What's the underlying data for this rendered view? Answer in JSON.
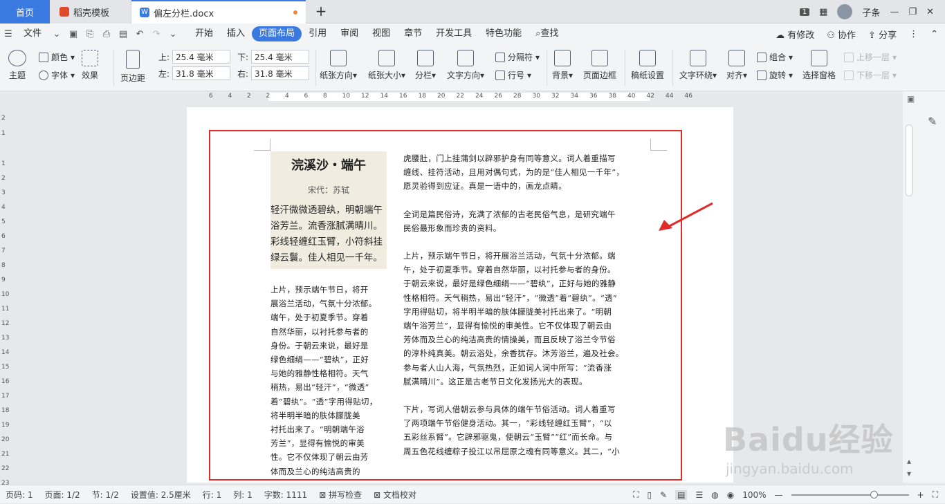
{
  "tabs": {
    "home": "首页",
    "template": "稻壳模板",
    "doc": "偏左分栏.docx",
    "add": "+"
  },
  "window": {
    "badge": "1",
    "user": "子条"
  },
  "menu": {
    "file": "文件",
    "items": [
      "开始",
      "插入",
      "页面布局",
      "引用",
      "审阅",
      "视图",
      "章节",
      "开发工具",
      "特色功能"
    ],
    "active_index": 2,
    "search": "查找",
    "right": [
      "有修改",
      "协作",
      "分享"
    ]
  },
  "ribbon": {
    "theme": "主题",
    "color": "颜色",
    "font": "字体",
    "effect": "效果",
    "margin": "页边距",
    "top_label": "上:",
    "top_value": "25.4 毫米",
    "bottom_label": "下:",
    "bottom_value": "25.4 毫米",
    "left_label": "左:",
    "left_value": "31.8 毫米",
    "right_label": "右:",
    "right_value": "31.8 毫米",
    "orientation": "纸张方向",
    "size": "纸张大小",
    "columns": "分栏",
    "text_direction": "文字方向",
    "separator": "分隔符",
    "line_number": "行号",
    "background": "背景",
    "page_border": "页面边框",
    "manuscript": "稿纸设置",
    "wrap": "文字环绕",
    "align": "对齐",
    "group": "组合",
    "rotate": "旋转",
    "selection_pane": "选择窗格",
    "bring_forward": "上移一层",
    "send_backward": "下移一层"
  },
  "ruler": {
    "h_ticks": [
      "6",
      "4",
      "2",
      "2",
      "4",
      "6",
      "8",
      "10",
      "12",
      "14",
      "16",
      "18",
      "20",
      "22",
      "24",
      "26",
      "28",
      "30",
      "32",
      "34",
      "36",
      "38",
      "40",
      "42",
      "44",
      "46"
    ],
    "v_ticks": [
      "2",
      "1",
      "1",
      "2",
      "3",
      "4",
      "5",
      "6",
      "7",
      "8",
      "9",
      "10",
      "11",
      "12",
      "13",
      "14",
      "15",
      "16",
      "17",
      "18",
      "19",
      "20",
      "21",
      "22",
      "23"
    ]
  },
  "document": {
    "poem_title": "浣溪沙・端午",
    "poem_author": "宋代：苏轼",
    "poem_lines": [
      "轻汗微微透碧纨，明朝端午",
      "浴芳兰。流香涨腻满晴川。",
      "彩线轻缠红玉臂，小符斜挂",
      "绿云鬟。佳人相见一千年。"
    ],
    "left_lines": [
      "上片，预示端午节日，将开",
      "展浴兰活动，气氛十分浓郁。",
      "端午，处于初夏季节。穿着",
      "自然华丽，以衬托参与者的",
      "身份。于朝云来说，最好是",
      "绿色细绢——“碧纨”，正好",
      "与她的雅静性格相符。天气",
      "稍热，易出“轻汗”，“微透”",
      "着“碧纨”。“透”字用得贴切，",
      "将半明半暗的肤体朦胧美",
      "衬托出来了。“明朝端午浴",
      "芳兰”，显得有愉悦的审美",
      "性。它不仅体现了朝云由芳",
      "体而及兰心的纯洁高贵的"
    ],
    "right_paragraphs": [
      [
        "虎腰肚，门上挂蒲剑以辟邪护身有同等意义。词人着重描写",
        "缠线、挂符活动，且用对偶句式，为的是“佳人相见一千年”，",
        "愿灵验得到应证。真是一语中的，画龙点睛。"
      ],
      [
        "全词是篇民俗诗，充满了浓郁的古老民俗气息，是研究端午",
        "民俗最形象而珍贵的资料。"
      ],
      [
        "上片，预示端午节日，将开展浴兰活动，气氛十分浓郁。端",
        "午，处于初夏季节。穿着自然华丽，以衬托参与者的身份。",
        "于朝云来说，最好是绿色细绢——“碧纨”，正好与她的雅静",
        "性格相符。天气稍热，易出“轻汗”，“微透”着“碧纨”。“透”",
        "字用得贴切，将半明半暗的肤体朦胧美衬托出来了。“明朝",
        "端午浴芳兰”，显得有愉悦的审美性。它不仅体现了朝云由",
        "芳体而及兰心的纯洁高贵的情操美，而且反映了浴兰令节俗",
        "的淳朴纯真美。朝云浴处，余香犹存。沐芳浴兰，遍及社会。",
        "参与者人山人海，气氛热烈，正如词人词中所写：“流香涨",
        "腻满晴川”。这正是古老节日文化发扬光大的表现。"
      ],
      [
        "下片，写词人借朝云参与具体的端午节俗活动。词人着重写",
        "了两项端午节俗健身活动。其一，“彩线轻缠红玉臂”，“以",
        "五彩丝系臂”。它辟邪驱鬼，使朝云“玉臂”“红”而长命。与",
        "周五色花线缠粽子投江以吊屈原之魂有同等意义。其二，“小"
      ]
    ]
  },
  "watermark": {
    "main": "Baidu经验",
    "sub": "jingyan.baidu.com"
  },
  "status": {
    "page_num": "页码: 1",
    "pages": "页面: 1/2",
    "section": "节: 1/2",
    "setting": "设置值: 2.5厘米",
    "row": "行: 1",
    "col": "列: 1",
    "words": "字数: 1111",
    "spell": "拼写检查",
    "proof": "文档校对",
    "zoom": "100%",
    "zoom_level": 0.7
  },
  "colors": {
    "accent": "#3a7ae0",
    "highlight_box": "#e02b2b",
    "poem_bg": "#f0ede0"
  }
}
